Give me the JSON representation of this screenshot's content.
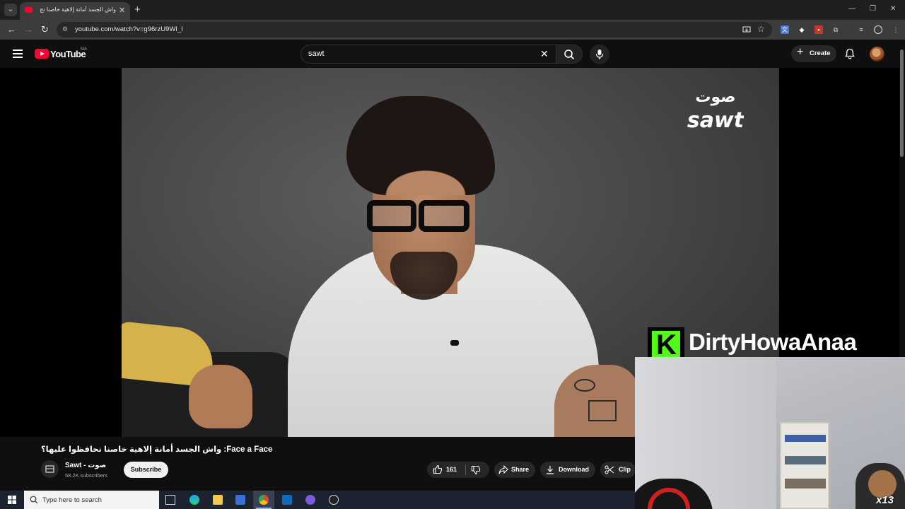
{
  "browser": {
    "tab_title": "واش الجسد أمانة إلاهية خاصنا نح",
    "url": "youtube.com/watch?v=g96rzU9WI_I",
    "controls": {
      "minimize": "—",
      "maximize": "❐",
      "close": "✕"
    }
  },
  "youtube": {
    "wordmark": "YouTube",
    "country_code": "MA",
    "search_value": "sawt",
    "create_label": "Create"
  },
  "video": {
    "title": "Face a Face: واش الجسد أمانة إلاهية خاصنا نحافظوا عليها؟",
    "channel_name": "Sawt - صوت",
    "subscribers": "58.2K subscribers",
    "subscribe_label": "Subscribe",
    "likes": "161",
    "share_label": "Share",
    "download_label": "Download",
    "clip_label": "Clip",
    "watermark_text": "صوت sawt"
  },
  "overlay": {
    "streamer_name": "DirtyHowaAnaa",
    "kick_letter": "K",
    "webcam_badge": "x13"
  },
  "taskbar": {
    "search_placeholder": "Type here to search"
  },
  "colors": {
    "youtube_red": "#ff0033",
    "kick_green": "#53fc18",
    "background": "#0f0f0f"
  }
}
